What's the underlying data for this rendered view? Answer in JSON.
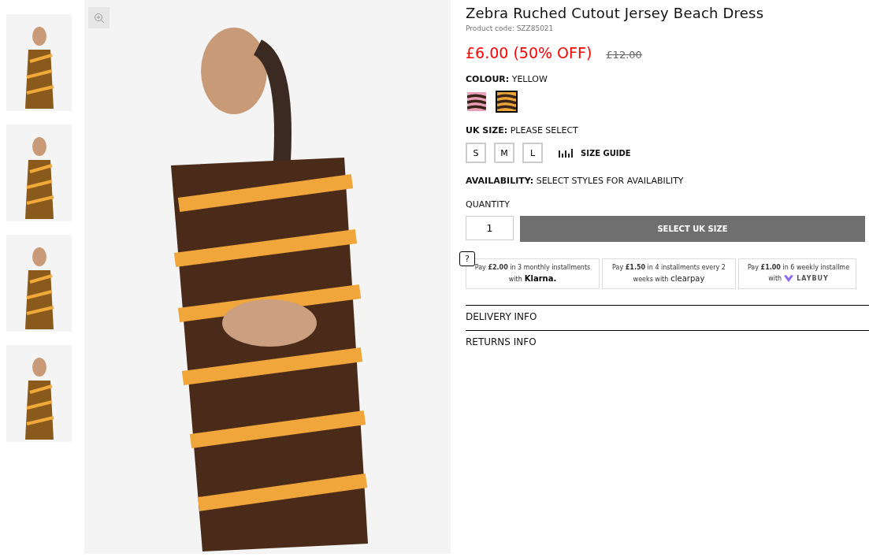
{
  "product": {
    "title": "Zebra Ruched Cutout Jersey Beach Dress",
    "code": "Product code: SZZ85021",
    "price": "£6.00 (50% OFF)",
    "was_price": "£12.00"
  },
  "colour": {
    "label": "COLOUR:",
    "value": "YELLOW",
    "swatches": [
      {
        "selected": false,
        "color": "#e8a0b8"
      },
      {
        "selected": true,
        "color": "#e9a53a"
      }
    ]
  },
  "size": {
    "label": "UK SIZE:",
    "value": "PLEASE SELECT",
    "options": [
      {
        "label": "S",
        "selected": false
      },
      {
        "label": "M",
        "selected": false
      },
      {
        "label": "L",
        "selected": false
      }
    ],
    "guide": "SIZE GUIDE"
  },
  "availability": {
    "label": "AVAILABILITY:",
    "value": "SELECT STYLES FOR AVAILABILITY"
  },
  "quantity": {
    "label": "QUANTITY",
    "value": "1"
  },
  "add_button": "SELECT UK SIZE",
  "help": "?",
  "payments": [
    {
      "text": "Pay **£2.00** in 3 monthly installments with",
      "brand": "Klarna."
    },
    {
      "text": "Pay **£1.50** in 4 installments every 2 weeks with",
      "brand": "clearpay"
    },
    {
      "text": "Pay **£1.00** in 6 weekly installme",
      "sub": "with",
      "brand": "LAYBUY"
    }
  ],
  "accordion": [
    {
      "label": "DELIVERY INFO"
    },
    {
      "label": "RETURNS INFO"
    }
  ]
}
